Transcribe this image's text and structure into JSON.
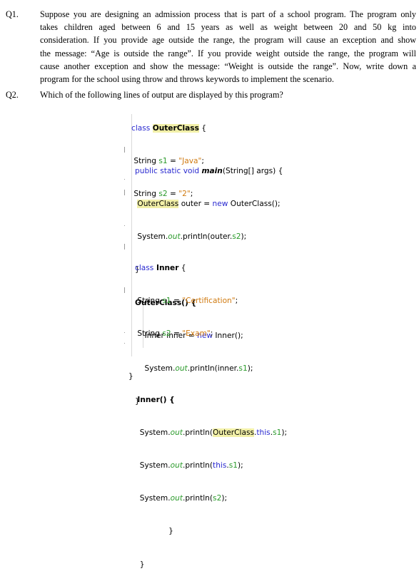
{
  "questions": [
    {
      "number": "Q1.",
      "lines": [
        "Suppose you are designing an admission process that is part of a school program. The program only",
        "takes children aged between 6 and 15 years as well as weight between 20 and 50 kg into",
        "consideration. If you provide age outside the range, the program will cause an exception and show",
        "the message: “Age is outside the range”. If you provide weight outside the range, the program will",
        "cause another exception and show the message: “Weight is outside the range”. Now, write down a",
        "program for the school using throw and throws keywords to implement the scenario."
      ]
    },
    {
      "number": "Q2.",
      "text": "Which of the following lines of output are displayed by this program?"
    }
  ],
  "code": {
    "outer_decl": {
      "kw": "class",
      "name": "OuterClass",
      "brace": " {"
    },
    "outer_fields": [
      {
        "type": "String ",
        "var": "s1",
        "eq": " = ",
        "value": "\"Java\"",
        "end": ";"
      },
      {
        "type": "String ",
        "var": "s2",
        "eq": " = ",
        "value": "\"2\"",
        "end": ";"
      }
    ],
    "main_sig": {
      "kw": "public static void ",
      "name": "main",
      "rest": "(String[] args) {"
    },
    "main_body": {
      "l1_type": "OuterClass",
      "l1_mid": " outer = ",
      "l1_kw": "new",
      "l1_rest": " OuterClass();",
      "l2_pre": "System.",
      "l2_out": "out",
      "l2_mid": ".println(outer.",
      "l2_var": "s2",
      "l2_end": ");"
    },
    "close": "}",
    "ctor_sig": "OuterClass() {",
    "ctor_body": {
      "l1_pre": "Inner inner = ",
      "l1_kw": "new",
      "l1_rest": " Inner();",
      "l2_pre": "System.",
      "l2_out": "out",
      "l2_mid": ".println(inner.",
      "l2_var": "s1",
      "l2_end": ");"
    },
    "inner_decl": {
      "kw": "class",
      "name": " Inner",
      "brace": " {"
    },
    "inner_fields": [
      {
        "type": "String ",
        "var": "s1",
        "eq": " = ",
        "value": "\"Certification\"",
        "end": ";"
      },
      {
        "type": "String ",
        "var": "s2",
        "eq": " = ",
        "value": "\"Exam\"",
        "end": ";"
      }
    ],
    "inner_ctor_sig": "Inner() {",
    "inner_ctor_body": [
      {
        "pre": "System.",
        "out": "out",
        "mid": ".println(",
        "hl": "OuterClass",
        "dot": ".",
        "kw": "this",
        "dot2": ".",
        "var": "s1",
        "end": ");"
      },
      {
        "pre": "System.",
        "out": "out",
        "mid": ".println(",
        "kw": "this",
        "dot": ".",
        "var": "s1",
        "end": ");"
      },
      {
        "pre": "System.",
        "out": "out",
        "mid": ".println(",
        "var": "s2",
        "end": ");"
      }
    ]
  }
}
